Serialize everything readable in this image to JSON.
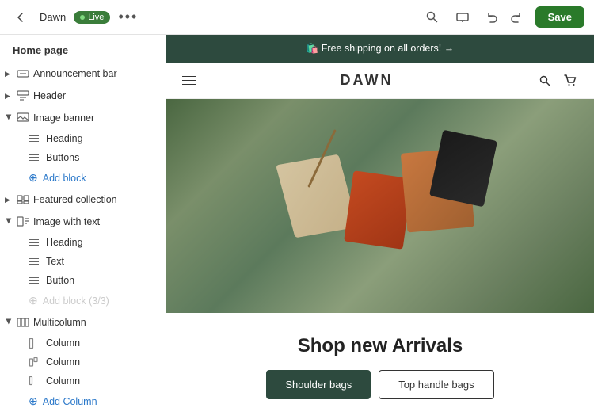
{
  "topbar": {
    "back_icon": "←",
    "store_name": "Dawn",
    "live_label": "Live",
    "more_icon": "•••",
    "search_icon": "🔍",
    "devices_icon": "🖥",
    "undo_icon": "↩",
    "redo_icon": "↪",
    "save_label": "Save"
  },
  "sidebar": {
    "page_title": "Home page",
    "items": [
      {
        "id": "announcement-bar",
        "label": "Announcement bar",
        "type": "section",
        "expanded": false
      },
      {
        "id": "header",
        "label": "Header",
        "type": "section",
        "expanded": false
      },
      {
        "id": "image-banner",
        "label": "Image banner",
        "type": "section",
        "expanded": true
      },
      {
        "id": "featured-collection",
        "label": "Featured collection",
        "type": "section",
        "expanded": false
      },
      {
        "id": "image-with-text",
        "label": "Image with text",
        "type": "section",
        "expanded": true
      },
      {
        "id": "multicolumn",
        "label": "Multicolumn",
        "type": "section",
        "expanded": true
      }
    ],
    "image_banner_subitems": [
      {
        "id": "heading",
        "label": "Heading"
      },
      {
        "id": "buttons",
        "label": "Buttons"
      }
    ],
    "add_block_label": "Add block",
    "image_with_text_subitems": [
      {
        "id": "heading2",
        "label": "Heading"
      },
      {
        "id": "text",
        "label": "Text"
      },
      {
        "id": "button",
        "label": "Button"
      }
    ],
    "add_block_disabled_label": "Add block (3/3)",
    "multicolumn_subitems": [
      {
        "id": "col1",
        "label": "Column"
      },
      {
        "id": "col2",
        "label": "Column"
      },
      {
        "id": "col3",
        "label": "Column"
      }
    ],
    "add_column_label": "Add Column"
  },
  "preview": {
    "announcement": "🛍️ Free shipping on all orders!  →",
    "brand_name": "DAWN",
    "arrivals_title": "Shop new Arrivals",
    "btn_filled": "Shoulder bags",
    "btn_outline": "Top handle bags"
  },
  "colors": {
    "live_green": "#3a7d3a",
    "save_green": "#2a7a2a",
    "announcement_bg": "#2d4a3e",
    "add_block_blue": "#2977c9"
  }
}
